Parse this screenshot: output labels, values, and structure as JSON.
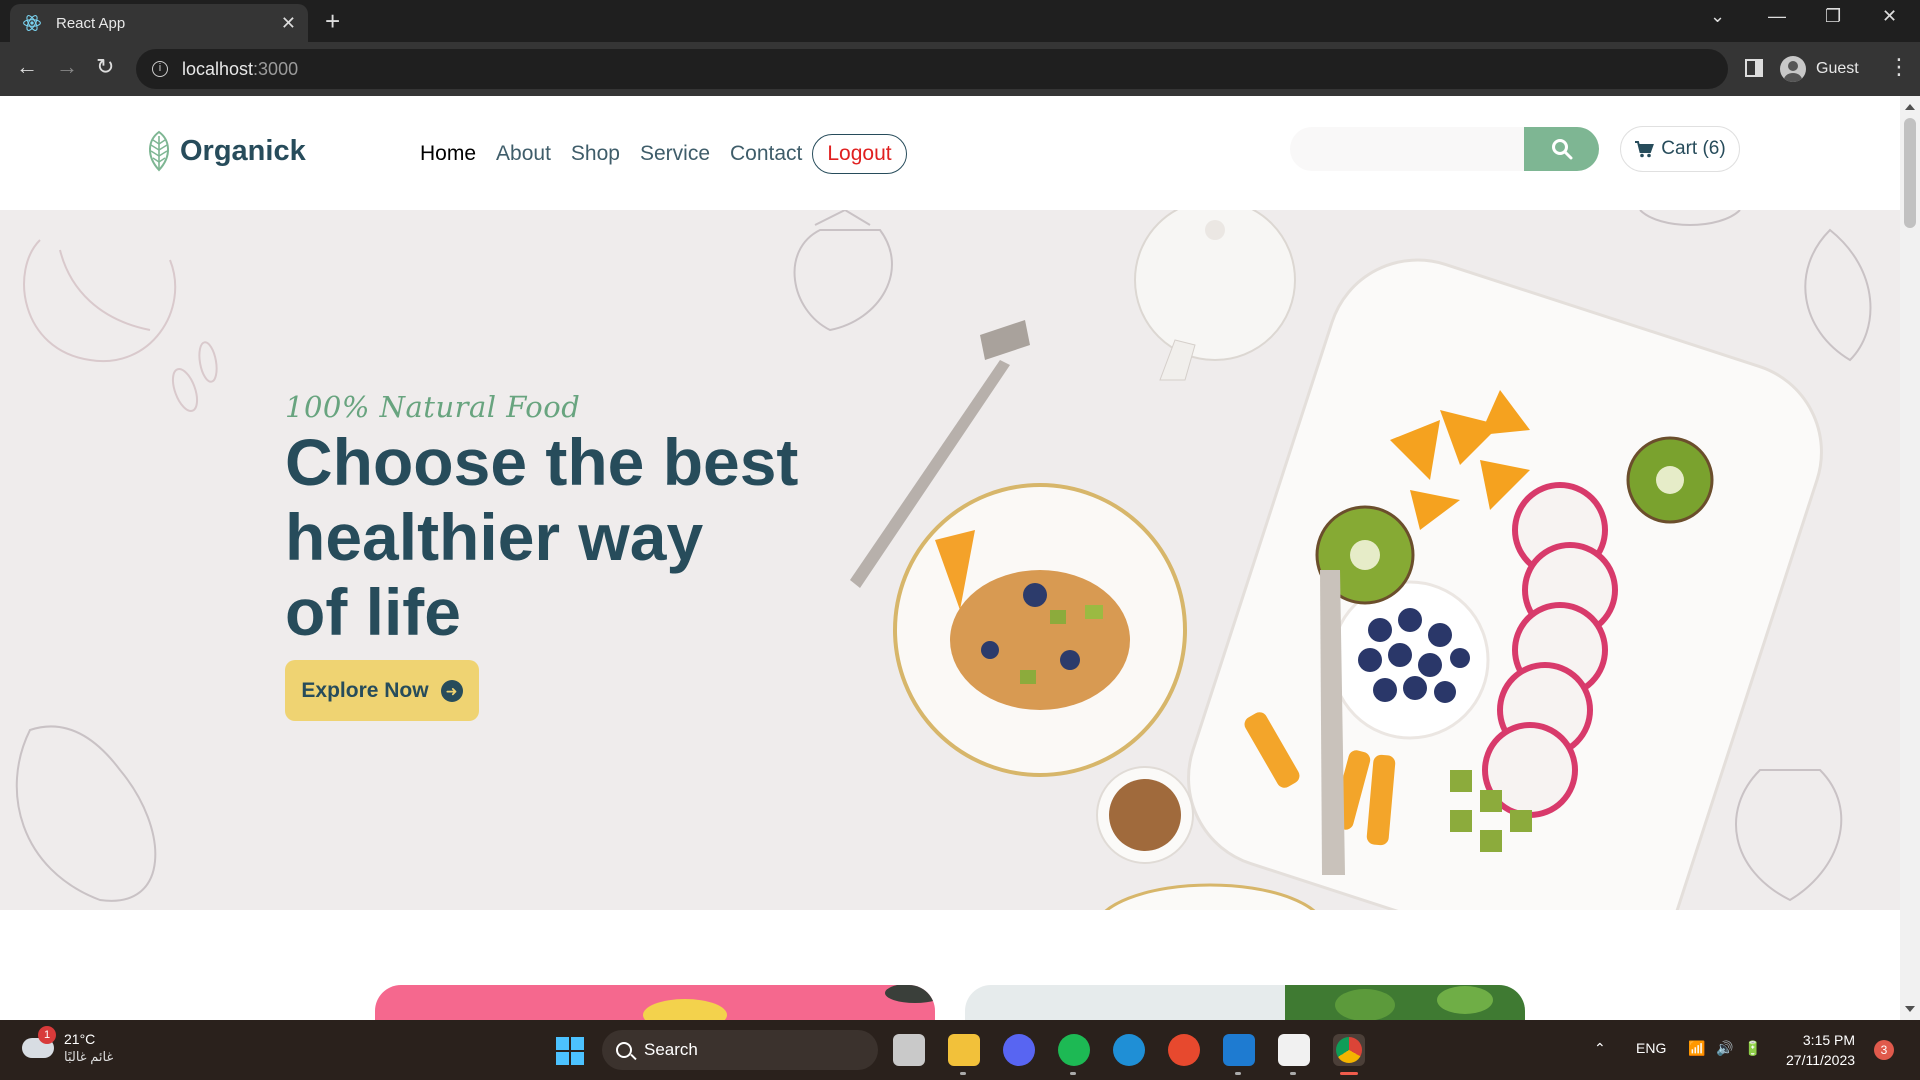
{
  "browser": {
    "tab_title": "React App",
    "url_host": "localhost",
    "url_port": ":3000",
    "profile_label": "Guest"
  },
  "site": {
    "logo_text": "Organick",
    "nav": [
      {
        "label": "Home"
      },
      {
        "label": "About"
      },
      {
        "label": "Shop"
      },
      {
        "label": "Service"
      },
      {
        "label": "Contact"
      }
    ],
    "logout_label": "Logout",
    "search_placeholder": "",
    "cart_label": "Cart (6)"
  },
  "hero": {
    "tagline": "100% Natural Food",
    "headline_line1": "Choose the best",
    "headline_line2": "healthier way",
    "headline_line3": "of life",
    "cta_label": "Explore Now"
  },
  "taskbar": {
    "weather_temp": "21°C",
    "weather_desc": "غائم غالبًا",
    "weather_badge": "1",
    "search_label": "Search",
    "lang": "ENG",
    "time": "3:15 PM",
    "date": "27/11/2023",
    "notifications": "3"
  },
  "colors": {
    "brand_dark": "#274c5b",
    "brand_green": "#7eb693",
    "cta_yellow": "#efd372",
    "logout_red": "#e02020",
    "hero_bg": "#efecec"
  },
  "icons": [
    "react-icon",
    "leaf-logo-icon",
    "search-icon",
    "cart-icon",
    "arrow-right-circle-icon",
    "back-icon",
    "forward-icon",
    "reload-icon",
    "info-icon"
  ]
}
